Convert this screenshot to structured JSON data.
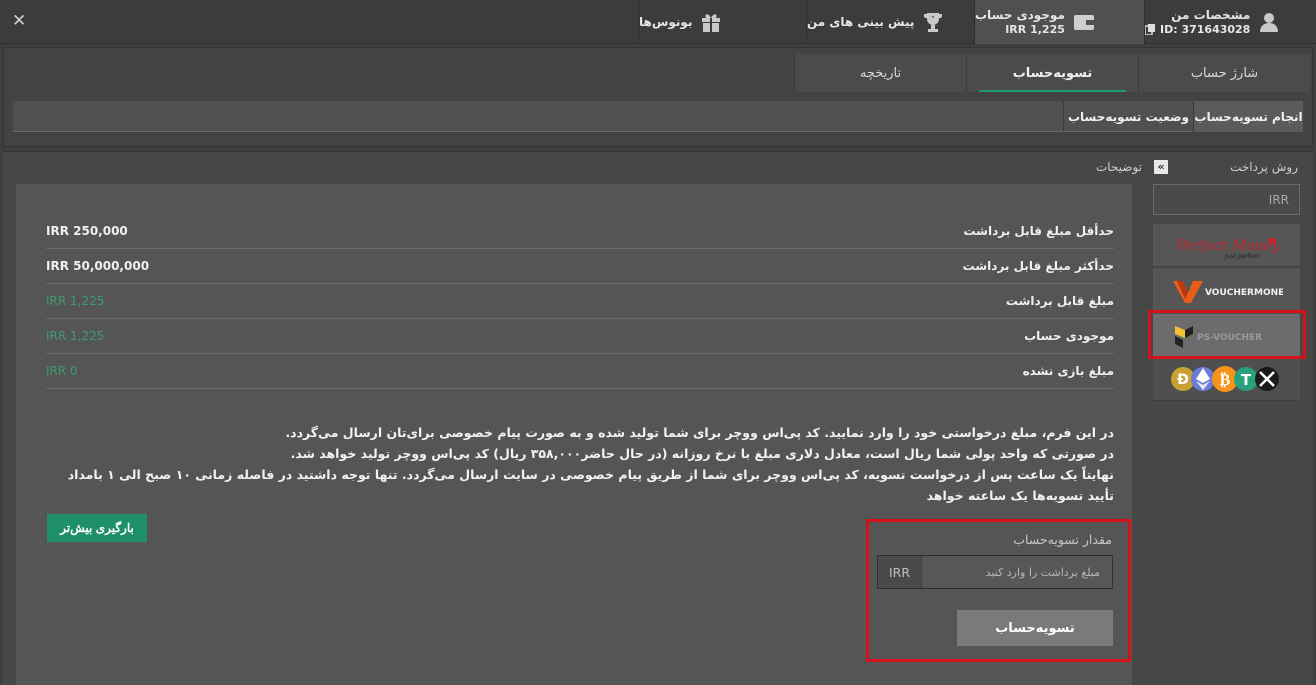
{
  "top_tabs": {
    "close_label": "✕",
    "profile": {
      "title": "مشخصات من",
      "id_text": "ID: 371643028"
    },
    "balance": {
      "title": "موجودی حساب",
      "amount": "IRR 1,225"
    },
    "predictions": {
      "title": "پیش بینی های من"
    },
    "bonuses": {
      "title": "بونوس‌ها"
    }
  },
  "sub_tabs": [
    {
      "label": "شارژ حساب"
    },
    {
      "label": "تسویه‌حساب"
    },
    {
      "label": "تاریخچه"
    }
  ],
  "section_tabs": {
    "do_settlement": "انجام تسویه‌حساب",
    "settlement_status": "وضعیت تسویه‌حساب"
  },
  "sidebar": {
    "payment_method_label": "روش پرداخت",
    "currency_placeholder": "IRR",
    "methods": [
      {
        "name": "Perfect Money",
        "tagline": "Just perfect"
      },
      {
        "name": "VOUCHERMONEY"
      },
      {
        "name": "PS-VOUCHER"
      },
      {
        "name": "crypto"
      }
    ]
  },
  "description_label": "توضیحات",
  "limits": [
    {
      "label": "حدأقل مبلغ قابل برداشت",
      "value": "IRR 250,000"
    },
    {
      "label": "حدأکثر مبلغ قابل برداشت",
      "value": "IRR 50,000,000"
    },
    {
      "label": "مبلغ قابل برداشت",
      "value": "IRR 1,225"
    },
    {
      "label": "موجودی حساب",
      "value": "IRR 1,225"
    },
    {
      "label": "مبلغ بازی نشده",
      "value": "IRR 0"
    }
  ],
  "info_lines": [
    "در این فرم، مبلغ درخواستی خود را وارد نمایید. کد پی‌اس ووچر برای شما تولید شده و به صورت پیام خصوصی برای‌تان ارسال می‌گردد.",
    "در صورتی که واحد پولی شما ریال است، معادل دلاری مبلغ با نرخ روزانه (در حال حاضر۳۵۸,۰۰۰ ریال) کد پی‌اس ووچر تولید خواهد شد.",
    "نهایتاً یک ساعت پس از درخواست تسویه، کد پی‌اس ووچر برای شما از طریق پیام خصوصی در سایت ارسال می‌گردد. تنها توجه داشتید در فاصله زمانی ۱۰ صبح الی ۱ بامداد تأیید تسویه‌ها یک ساعته خواهد"
  ],
  "load_more": "بارگیری بیش‌تر",
  "settle_form": {
    "label": "مقدار تسویه‌حساب",
    "currency": "IRR",
    "placeholder": "مبلغ برداشت را وارد کنید",
    "submit": "تسویه‌حساب"
  }
}
